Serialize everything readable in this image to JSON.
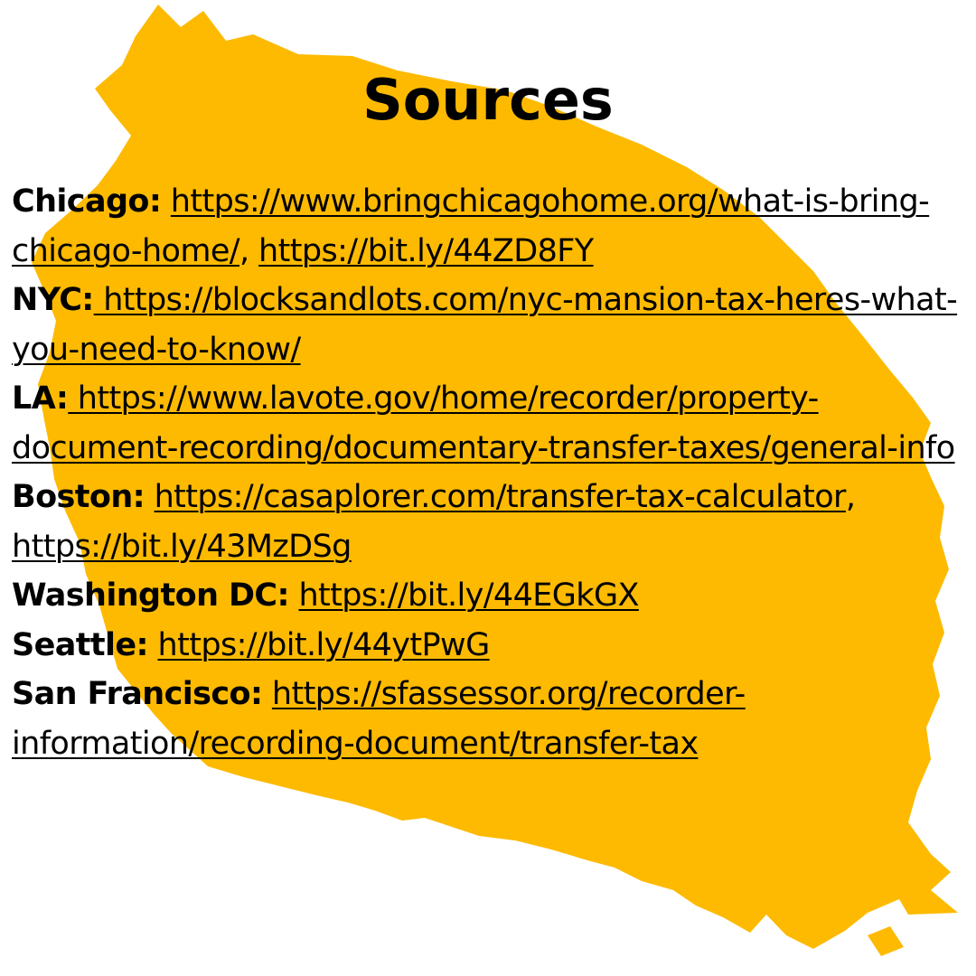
{
  "title": "Sources",
  "accent_color": "#FDBA00",
  "entries": [
    {
      "city": "Chicago:",
      "links": [
        {
          "text": "https://www.bringchicagohome.org/what-is-bring-chicago-home/"
        },
        {
          "text": "https://bit.ly/44ZD8FY"
        }
      ],
      "separator": ", "
    },
    {
      "city": "NYC:",
      "links": [
        {
          "text": " https://blocksandlots.com/nyc-mansion-tax-heres-what-you-need-to-know/"
        }
      ]
    },
    {
      "city": "LA:",
      "links": [
        {
          "text": " https://www.lavote.gov/home/recorder/property-document-recording/documentary-transfer-taxes/general-info"
        }
      ]
    },
    {
      "city": "Boston:",
      "links": [
        {
          "text": "https://casaplorer.com/transfer-tax-calculator"
        },
        {
          "text": "https://bit.ly/43MzDSg"
        }
      ],
      "separator": ", "
    },
    {
      "city": "Washington DC:",
      "links": [
        {
          "text": "https://bit.ly/44EGkGX"
        }
      ]
    },
    {
      "city": "Seattle:",
      "links": [
        {
          "text": "https://bit.ly/44ytPwG"
        }
      ]
    },
    {
      "city": "San Francisco:",
      "links": [
        {
          "text": "https://sfassessor.org/recorder-information/recording-document/transfer-tax"
        }
      ]
    }
  ]
}
